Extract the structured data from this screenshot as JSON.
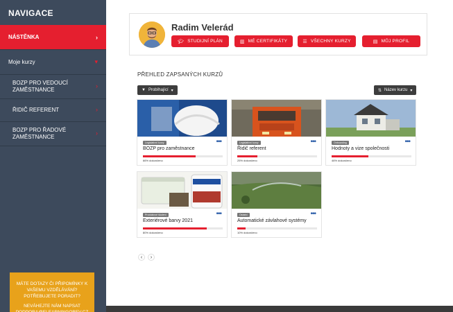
{
  "sidebar": {
    "title": "NAVIGACE",
    "toggle_icon": "chevron-left-icon",
    "items": [
      {
        "label": "NÁSTĚNKA",
        "active": true
      },
      {
        "label": "Moje kurzy"
      },
      {
        "label": "BOZP PRO VEDOUCÍ ZAMĚSTNANCE"
      },
      {
        "label": "ŘIDIČ REFERENT"
      },
      {
        "label": "BOZP PRO ŘADOVÉ ZAMĚSTNANCE"
      }
    ],
    "promo": {
      "line1": "MÁTE DOTAZY ČI PŘIPOMÍNKY K VAŠEMU VZDĚLÁVÁNÍ? POTŘEBUJETE PORADIT?",
      "line2": "NEVÁHEJTE NÁM NAPSAT PODPORA@ELEARNINGOBEV.CZ"
    }
  },
  "profile": {
    "name": "Radim Velerád",
    "buttons": [
      {
        "label": "STUDIJNÍ PLÁN",
        "icon": "graduation-cap-icon"
      },
      {
        "label": "MÉ CERTIFIKÁTY",
        "icon": "chart-icon"
      },
      {
        "label": "VŠECHNY KURZY",
        "icon": "list-icon"
      },
      {
        "label": "MŮJ PROFIL",
        "icon": "id-card-icon"
      }
    ]
  },
  "courses": {
    "section_title": "PŘEHLED ZAPSANÝCH KURZŮ",
    "filter_label": "Probíhající",
    "sort_label": "Název kurzu",
    "items": [
      {
        "tag": "Legislativní kurzy",
        "title": "BOZP pro zaměstnance",
        "progress": 66,
        "progress_text": "66% dokončeno"
      },
      {
        "tag": "Legislativní kurzy",
        "title": "Řidič referent",
        "progress": 25,
        "progress_text": "25% dokončeno"
      },
      {
        "tag": "Onboarding",
        "title": "Hodnoty a vize společnosti",
        "progress": 46,
        "progress_text": "46% dokončeno"
      },
      {
        "tag": "Produktové školení",
        "title": "Exteriérové barvy 2021",
        "progress": 80,
        "progress_text": "80% dokončeno"
      },
      {
        "tag": "Ostatní",
        "title": "Automatické závlahové systémy",
        "progress": 10,
        "progress_text": "10% dokončeno"
      }
    ],
    "pager": {
      "prev": "‹",
      "next": "›"
    }
  },
  "colors": {
    "accent": "#e51f2f",
    "sidebar": "#3d4a5c",
    "promo": "#e8a21b"
  }
}
